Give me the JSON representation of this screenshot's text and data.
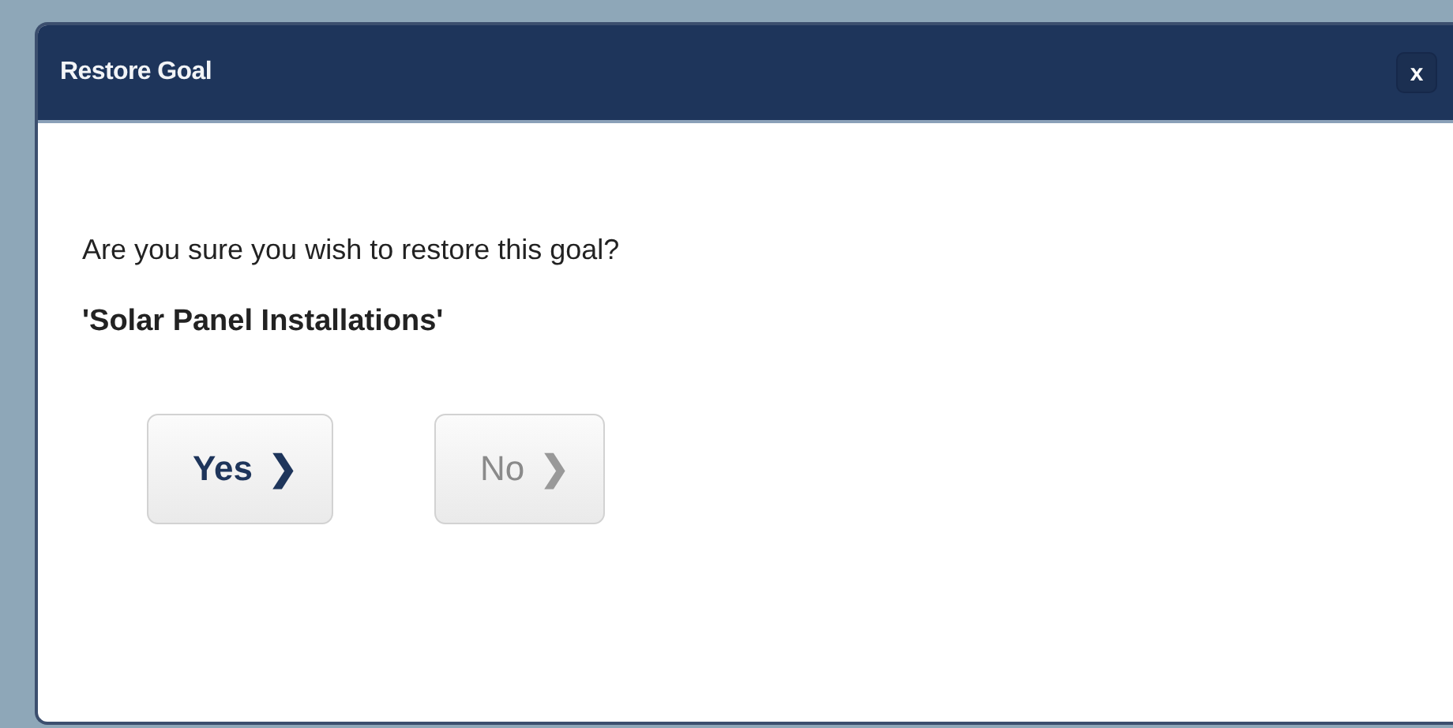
{
  "dialog": {
    "title": "Restore Goal",
    "close": "x",
    "message": "Are you sure you wish to restore this goal?",
    "item": "'Solar Panel Installations'",
    "buttons": [
      {
        "label": "Yes",
        "icon": "❯",
        "disabled": false
      },
      {
        "label": "No",
        "icon": "❯",
        "disabled": true
      }
    ]
  }
}
